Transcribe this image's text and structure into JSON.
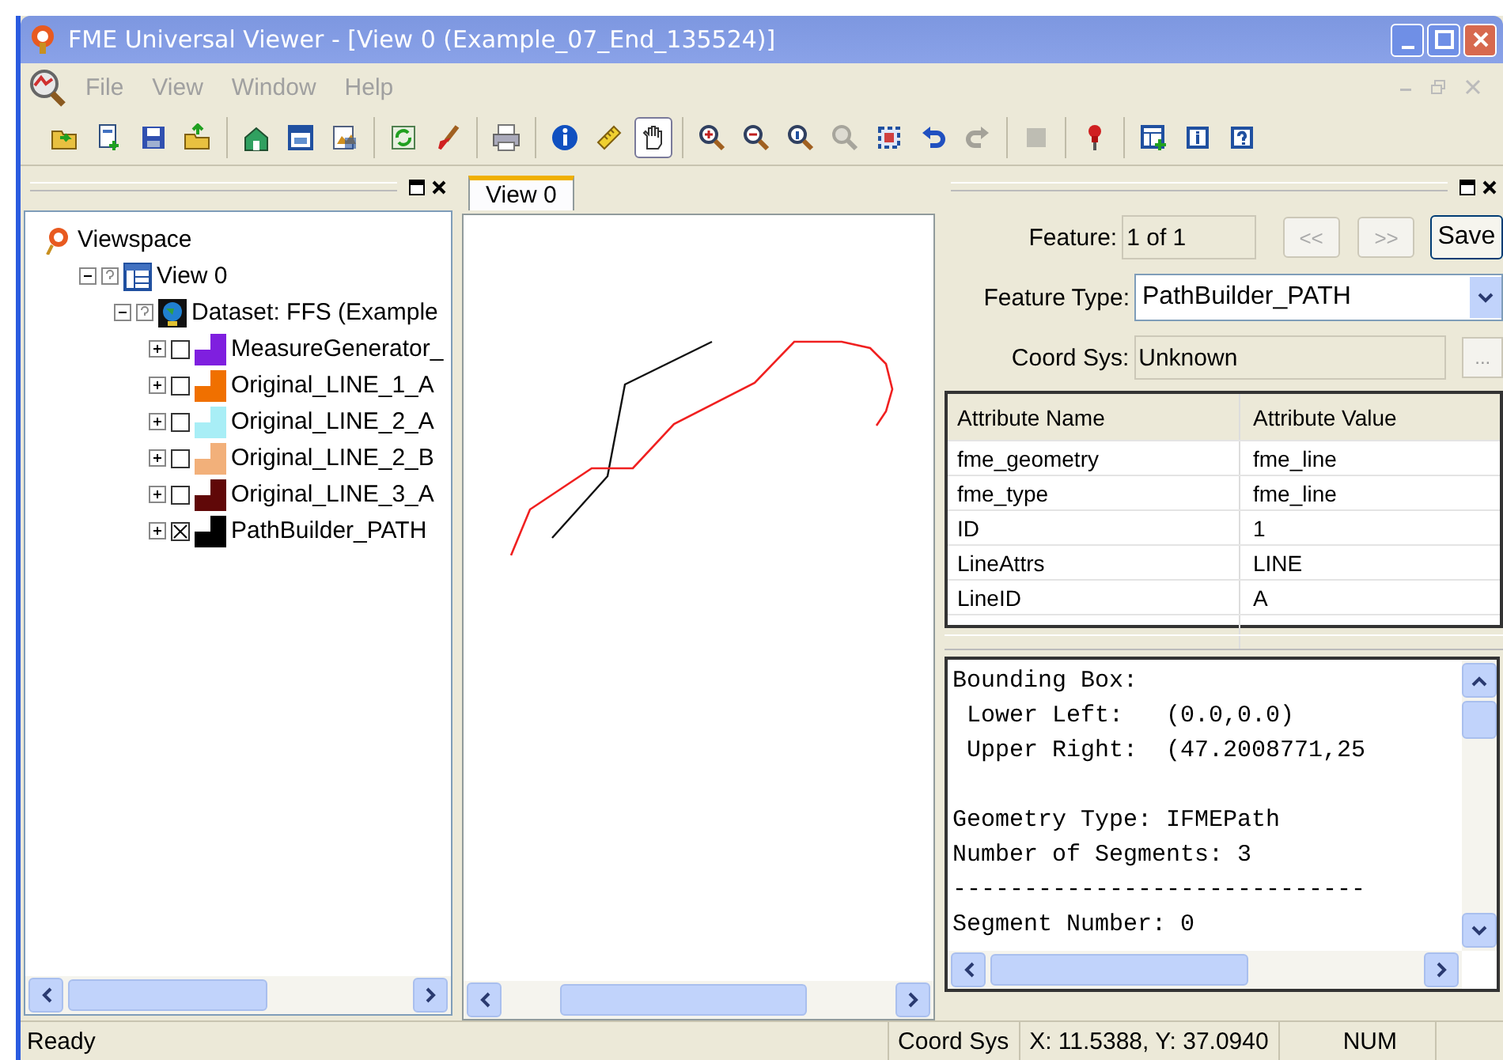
{
  "window": {
    "title": "FME Universal Viewer - [View 0 (Example_07_End_135524)]"
  },
  "menu": [
    "File",
    "View",
    "Window",
    "Help"
  ],
  "toolbar_groups": [
    {
      "buttons": [
        {
          "selected": false,
          "disabled": false
        },
        {
          "selected": false,
          "disabled": false
        },
        {
          "selected": false,
          "disabled": false
        },
        {
          "selected": false,
          "disabled": false
        }
      ]
    },
    {
      "buttons": [
        {
          "selected": false,
          "disabled": false
        },
        {
          "selected": false,
          "disabled": false
        },
        {
          "selected": false,
          "disabled": false
        }
      ]
    },
    {
      "buttons": [
        {
          "selected": false,
          "disabled": false
        },
        {
          "selected": false,
          "disabled": false
        }
      ]
    },
    {
      "buttons": [
        {
          "selected": false,
          "disabled": false
        }
      ]
    },
    {
      "buttons": [
        {
          "selected": false,
          "disabled": false
        },
        {
          "selected": false,
          "disabled": false
        },
        {
          "selected": true,
          "disabled": false
        }
      ]
    },
    {
      "buttons": [
        {
          "selected": false,
          "disabled": false
        },
        {
          "selected": false,
          "disabled": false
        },
        {
          "selected": false,
          "disabled": false
        },
        {
          "selected": false,
          "disabled": true
        },
        {
          "selected": false,
          "disabled": false
        },
        {
          "selected": false,
          "disabled": false
        },
        {
          "selected": false,
          "disabled": true
        }
      ]
    },
    {
      "buttons": [
        {
          "selected": false,
          "disabled": true
        }
      ]
    },
    {
      "buttons": [
        {
          "selected": false,
          "disabled": false
        }
      ]
    },
    {
      "buttons": [
        {
          "selected": false,
          "disabled": false
        },
        {
          "selected": false,
          "disabled": false
        },
        {
          "selected": false,
          "disabled": false
        }
      ]
    }
  ],
  "tree": [
    {
      "kind": "viewspace",
      "label": "Viewspace",
      "children": [
        {
          "kind": "view",
          "label": "View 0",
          "expanded": true,
          "children": [
            {
              "kind": "dataset",
              "label": "Dataset: FFS (Example",
              "expanded": true,
              "children": [
                {
                  "kind": "layer",
                  "label": "MeasureGenerator_",
                  "expanded": false,
                  "checked": false,
                  "color": "#7f1fdf"
                },
                {
                  "kind": "layer",
                  "label": "Original_LINE_1_A",
                  "expanded": false,
                  "checked": false,
                  "color": "#f07000"
                },
                {
                  "kind": "layer",
                  "label": "Original_LINE_2_A",
                  "expanded": false,
                  "checked": false,
                  "color": "#a8eef6"
                },
                {
                  "kind": "layer",
                  "label": "Original_LINE_2_B",
                  "expanded": false,
                  "checked": false,
                  "color": "#f2b07a"
                },
                {
                  "kind": "layer",
                  "label": "Original_LINE_3_A",
                  "expanded": false,
                  "checked": false,
                  "color": "#600808"
                },
                {
                  "kind": "layer",
                  "label": "PathBuilder_PATH",
                  "expanded": false,
                  "checked": true,
                  "color": "#000000"
                }
              ]
            }
          ]
        }
      ]
    }
  ],
  "view_tabs": [
    {
      "label": "View 0",
      "selected": true
    }
  ],
  "feature": {
    "label": "Feature:",
    "value": "1 of 1",
    "prev": "<<",
    "next": ">>",
    "save": "Save"
  },
  "feature_type": {
    "label": "Feature Type:",
    "value": "PathBuilder_PATH"
  },
  "coord_sys": {
    "label": "Coord Sys:",
    "value": "Unknown",
    "browse": "..."
  },
  "attributes": {
    "columns": [
      "Attribute Name",
      "Attribute Value"
    ],
    "rows": [
      [
        "fme_geometry",
        "fme_line"
      ],
      [
        "fme_type",
        "fme_line"
      ],
      [
        "ID",
        "1"
      ],
      [
        "LineAttrs",
        "LINE"
      ],
      [
        "LineID",
        "A"
      ]
    ]
  },
  "info_blocks": [
    [
      "Bounding Box:",
      " Lower Left:   (0.0,0.0)",
      " Upper Right:  (47.2008771,25"
    ],
    [
      "Geometry Type: IFMEPath",
      "Number of Segments: 3",
      "-----------------------------",
      "Segment Number: 0"
    ]
  ],
  "status_bar": {
    "message": "Ready",
    "coord_label": "Coord Sys",
    "coords": "X: 11.5388, Y: 37.0940",
    "num": "NUM"
  }
}
